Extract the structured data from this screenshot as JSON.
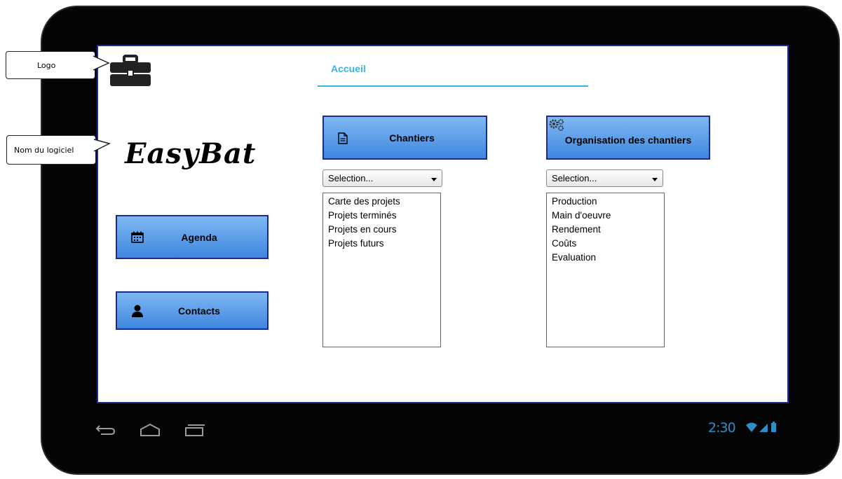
{
  "callouts": {
    "logo": "Logo",
    "name": "Nom du logiciel"
  },
  "app": {
    "name": "EasyBat"
  },
  "tabs": [
    {
      "label": "Accueil",
      "active": true
    }
  ],
  "sidebar": {
    "agenda_label": "Agenda",
    "contacts_label": "Contacts"
  },
  "chantiers": {
    "button_label": "Chantiers",
    "select_value": "Selection...",
    "items": [
      "Carte des projets",
      "Projets terminés",
      "Projets en cours",
      "Projets futurs"
    ]
  },
  "organisation": {
    "button_label": "Organisation des chantiers",
    "select_value": "Selection...",
    "items": [
      "Production",
      "Main d'oeuvre",
      "Rendement",
      "Coûts",
      "Evaluation"
    ]
  },
  "system_bar": {
    "time": "2:30",
    "nav_icons": [
      "back-icon",
      "home-icon",
      "recent-apps-icon"
    ],
    "status_icons": [
      "wifi-icon",
      "signal-icon",
      "battery-icon"
    ]
  },
  "colors": {
    "accent": "#3bb4e3",
    "button_top": "#7fb9f2",
    "button_bottom": "#3f86df",
    "button_border": "#1b2a8c",
    "clock": "#2f8ec7"
  }
}
